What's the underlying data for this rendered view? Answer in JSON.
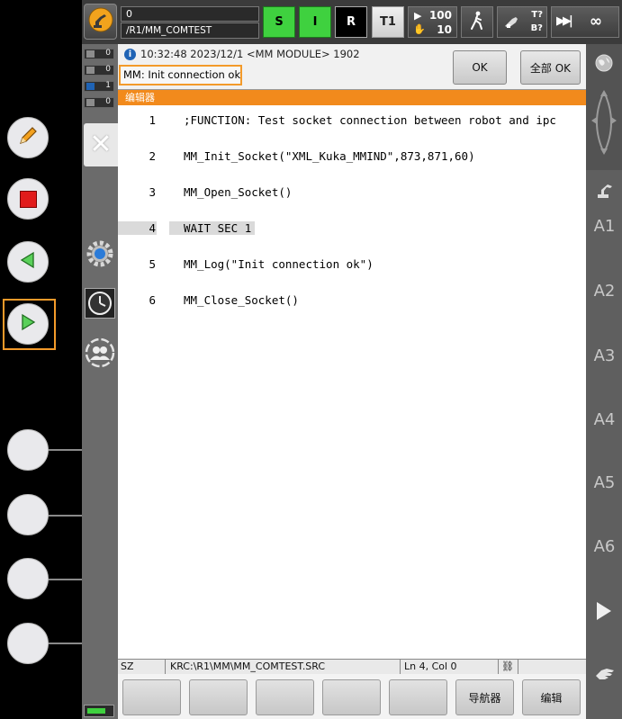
{
  "topbar": {
    "program_number": "0",
    "program_path": "/R1/MM_COMTEST",
    "submit_status": "S",
    "drive_status": "I",
    "robot_status": "R",
    "mode": "T1",
    "override_prog": "100",
    "override_jog": "10",
    "tool_label_top": "T?",
    "tool_label_bottom": "B?",
    "increment": "∞"
  },
  "message_counters": [
    {
      "type": "ack",
      "value": "0"
    },
    {
      "type": "state",
      "value": "0"
    },
    {
      "type": "info",
      "value": "1"
    },
    {
      "type": "wait",
      "value": "0"
    }
  ],
  "message": {
    "timestamp": "10:32:48 2023/12/1",
    "source": "<MM MODULE>",
    "code": "1902",
    "text": "MM: Init connection ok",
    "ok_label": "OK",
    "all_ok_label": "全部 OK"
  },
  "editor": {
    "title": "编辑器",
    "lines": [
      {
        "num": "1",
        "text": ";FUNCTION: Test socket connection between robot and ipc"
      },
      {
        "num": "2",
        "text": "MM_Init_Socket(\"XML_Kuka_MMIND\",873,871,60)"
      },
      {
        "num": "3",
        "text": "MM_Open_Socket()"
      },
      {
        "num": "4",
        "text": "WAIT SEC 1"
      },
      {
        "num": "5",
        "text": "MM_Log(\"Init connection ok\")"
      },
      {
        "num": "6",
        "text": "MM_Close_Socket()"
      }
    ]
  },
  "statusbar": {
    "mode": "SZ",
    "file": "KRC:\\R1\\MM\\MM_COMTEST.SRC",
    "position": "Ln 4, Col 0"
  },
  "softkeys": {
    "navigator_label": "导航器",
    "edit_label": "编辑"
  },
  "right_axes": [
    "A1",
    "A2",
    "A3",
    "A4",
    "A5",
    "A6"
  ],
  "colors": {
    "accent_orange": "#f28a1c",
    "status_green": "#3fd13f",
    "highlight_box": "#f39a2a"
  }
}
